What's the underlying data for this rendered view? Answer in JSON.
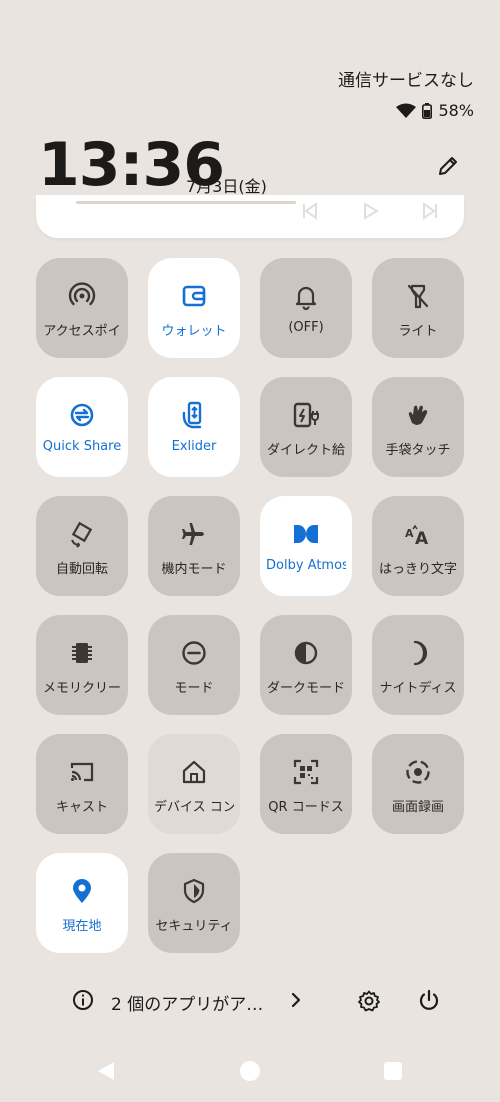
{
  "status": {
    "carrier": "通信サービスなし",
    "battery": "58%"
  },
  "header": {
    "time": "13:36",
    "date": "7月3日(金)"
  },
  "colors": {
    "background": "#e9e4e0",
    "tile_off": "#cac5c1",
    "tile_on": "#ffffff",
    "accent": "#1570d4"
  },
  "tiles": [
    {
      "label": "アクセスポイ",
      "icon": "hotspot-icon",
      "state": "off"
    },
    {
      "label": "ウォレット",
      "icon": "wallet-icon",
      "state": "on"
    },
    {
      "label": "(OFF)",
      "icon": "bell-icon",
      "state": "off"
    },
    {
      "label": "ライト",
      "icon": "flashlight-off-icon",
      "state": "off"
    },
    {
      "label": "Quick Share",
      "icon": "quick-share-icon",
      "state": "on"
    },
    {
      "label": "Exlider",
      "icon": "exlider-icon",
      "state": "on"
    },
    {
      "label": "ダイレクト給",
      "icon": "direct-charge-icon",
      "state": "off"
    },
    {
      "label": "手袋タッチ",
      "icon": "glove-icon",
      "state": "off"
    },
    {
      "label": "自動回転",
      "icon": "auto-rotate-icon",
      "state": "off"
    },
    {
      "label": "機内モード",
      "icon": "airplane-icon",
      "state": "off"
    },
    {
      "label": "Dolby Atmos",
      "icon": "dolby-icon",
      "state": "on"
    },
    {
      "label": "はっきり文字",
      "icon": "font-size-icon",
      "state": "off"
    },
    {
      "label": "メモリクリー",
      "icon": "memory-chip-icon",
      "state": "off"
    },
    {
      "label": "モード",
      "icon": "do-not-disturb-icon",
      "state": "off"
    },
    {
      "label": "ダークモード",
      "icon": "dark-mode-icon",
      "state": "off"
    },
    {
      "label": "ナイトディス",
      "icon": "night-light-icon",
      "state": "off"
    },
    {
      "label": "キャスト",
      "icon": "cast-icon",
      "state": "off"
    },
    {
      "label": "デバイス コン",
      "icon": "home-icon",
      "state": "dim"
    },
    {
      "label": "QR コードス",
      "icon": "qr-scan-icon",
      "state": "off"
    },
    {
      "label": "画面録画",
      "icon": "screen-record-icon",
      "state": "off"
    },
    {
      "label": "現在地",
      "icon": "location-icon",
      "state": "on"
    },
    {
      "label": "セキュリティ",
      "icon": "shield-icon",
      "state": "off"
    }
  ],
  "footer": {
    "message": "2 個のアプリがア…"
  }
}
